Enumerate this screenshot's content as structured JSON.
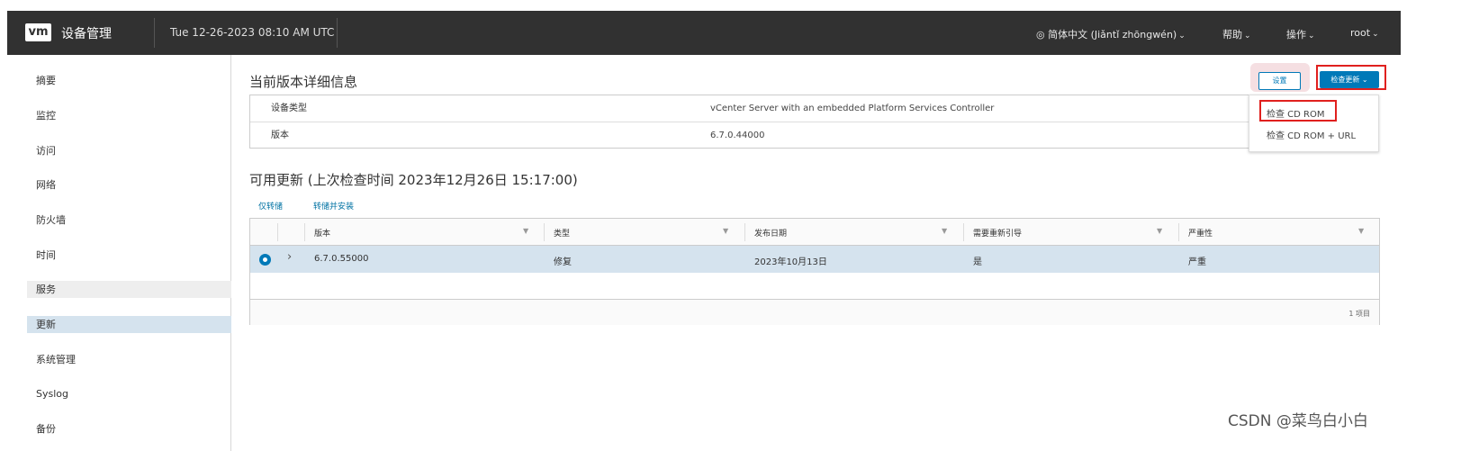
{
  "header": {
    "logo": "vm",
    "app_title": "设备管理",
    "datetime": "Tue 12-26-2023 08:10 AM UTC",
    "language": "◎ 简体中文 (Jiǎntǐ zhōngwén)",
    "help": "帮助",
    "actions": "操作",
    "user": "root",
    "chevron": "⌄"
  },
  "sidebar": {
    "items": [
      {
        "label": "摘要"
      },
      {
        "label": "监控"
      },
      {
        "label": "访问"
      },
      {
        "label": "网络"
      },
      {
        "label": "防火墙"
      },
      {
        "label": "时间"
      },
      {
        "label": "服务"
      },
      {
        "label": "更新"
      },
      {
        "label": "系统管理"
      },
      {
        "label": "Syslog"
      },
      {
        "label": "备份"
      }
    ],
    "active": "更新"
  },
  "current_version": {
    "title": "当前版本详细信息",
    "rows": [
      {
        "label": "设备类型",
        "value": "vCenter Server with an embedded Platform Services Controller"
      },
      {
        "label": "版本",
        "value": "6.7.0.44000"
      }
    ]
  },
  "toolbar": {
    "settings_label": "设置",
    "check_updates_label": "检查更新 ⌄",
    "dropdown": [
      "检查 CD ROM",
      "检查 CD ROM + URL"
    ]
  },
  "updates": {
    "title": "可用更新 (上次检查时间 2023年12月26日 15:17:00)",
    "tabs": [
      "仅转储",
      "转储并安装"
    ],
    "columns": [
      "版本",
      "类型",
      "发布日期",
      "需要重新引导",
      "严重性"
    ],
    "filter_glyph": "▼",
    "expander_glyph": "›",
    "rows": [
      {
        "version": "6.7.0.55000",
        "type": "修复",
        "release_date": "2023年10月13日",
        "reboot": "是",
        "severity": "严重"
      }
    ],
    "footer": "1 项目"
  },
  "watermark": "CSDN @菜鸟白小白"
}
